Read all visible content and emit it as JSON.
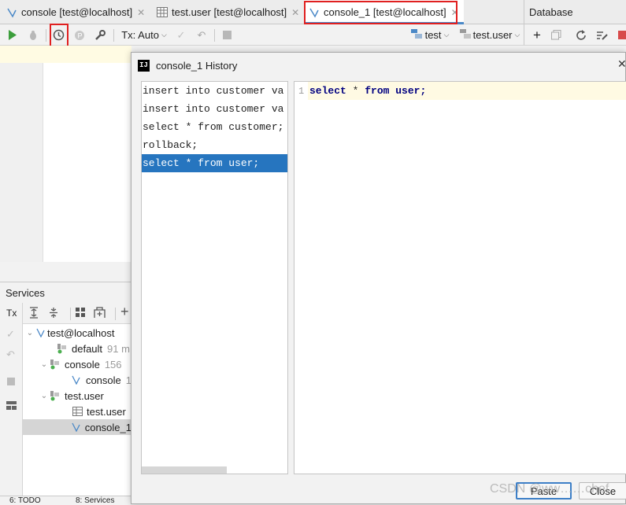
{
  "tabs": [
    {
      "label": "console [test@localhost]",
      "icon": "sql-console-icon"
    },
    {
      "label": "test.user [test@localhost]",
      "icon": "table-icon"
    },
    {
      "label": "console_1 [test@localhost]",
      "icon": "sql-console-icon",
      "active": true
    }
  ],
  "database_panel": {
    "title": "Database"
  },
  "toolbar": {
    "tx_label": "Tx: Auto",
    "schema_label": "test",
    "table_label": "test.user"
  },
  "services": {
    "title": "Services",
    "tx_label": "Tx",
    "tree": [
      {
        "label": "test@localhost",
        "meta": ""
      },
      {
        "label": "default",
        "meta": "91 m"
      },
      {
        "label": "console",
        "meta": "156"
      },
      {
        "label": "console",
        "meta": "1"
      },
      {
        "label": "test.user",
        "meta": ""
      },
      {
        "label": "test.user",
        "meta": ""
      },
      {
        "label": "console_1",
        "meta": ""
      }
    ]
  },
  "statusbar": {
    "todo": "6: TODO",
    "services": "8: Services"
  },
  "dialog": {
    "title": "console_1 History",
    "logo": "IJ",
    "history": [
      "insert into customer va",
      "insert into customer va",
      "select * from customer;",
      "rollback;",
      "select * from user;"
    ],
    "selected_index": 4,
    "preview_line_number": "1",
    "preview": {
      "kw1": "select",
      "star": " * ",
      "kw2": "from",
      "rest": " user;"
    },
    "paste_label": "Paste",
    "close_label": "Close",
    "watermark": "CSDN @ww……chef"
  },
  "colors": {
    "accent": "#2675bf",
    "highlight_box": "#e02020",
    "run_green": "#3c9e3c"
  }
}
